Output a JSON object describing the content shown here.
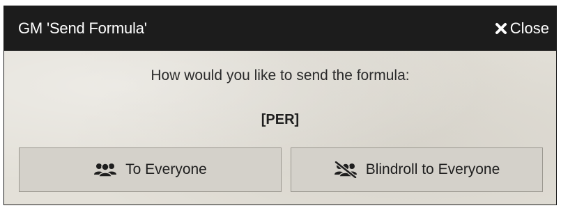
{
  "dialog": {
    "title": "GM 'Send Formula'",
    "close_label": "Close",
    "close_icon": "close-icon",
    "prompt": "How would you like to send the formula:",
    "formula": "[PER]",
    "buttons": [
      {
        "label": "To Everyone",
        "icon": "users-icon"
      },
      {
        "label": "Blindroll to Everyone",
        "icon": "users-slash-icon"
      }
    ]
  },
  "colors": {
    "titlebar_bg": "#1c1c1c",
    "titlebar_text": "#ffffff",
    "dialog_bg": "#e3e0d8",
    "button_bg": "#d4d1ca",
    "button_border": "#9a978f",
    "text": "#1e1e1e"
  }
}
